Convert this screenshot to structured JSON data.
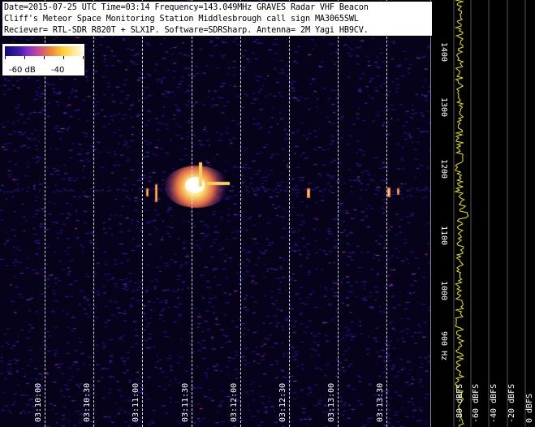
{
  "info": {
    "line1": "Date=2015-07-25 UTC Time=03:14 Frequency=143.049MHz GRAVES Radar VHF Beacon",
    "line2": "Cliff's Meteor Space Monitoring Station Middlesbrough call sign MA3065SWL",
    "line3": "Reciever= RTL-SDR R820T + SLX1P. Software=SDRSharp. Antenna= 2M Yagi HB9CV."
  },
  "legend": {
    "low_label": "-60 dB",
    "high_label": "-40"
  },
  "time_axis": {
    "labels": [
      "03:10:00",
      "03:10:30",
      "03:11:00",
      "03:11:30",
      "03:12:00",
      "03:12:30",
      "03:13:00",
      "03:13:30"
    ]
  },
  "freq_axis": {
    "labels": [
      "1400",
      "1300",
      "1200",
      "1100",
      "1000",
      "900 Hz"
    ]
  },
  "spectrum": {
    "db_labels": [
      "-80 dBFS",
      "-60 dBFS",
      "-40 dBFS",
      "-20 dBFS",
      "0 dBFS"
    ],
    "trace_color": "#e8e800",
    "grid_color": "#555555"
  },
  "colors": {
    "background": "#05021a",
    "low": "#2a1a9a",
    "mid": "#c03a90",
    "high": "#ffe070",
    "peak": "#ffffff"
  }
}
